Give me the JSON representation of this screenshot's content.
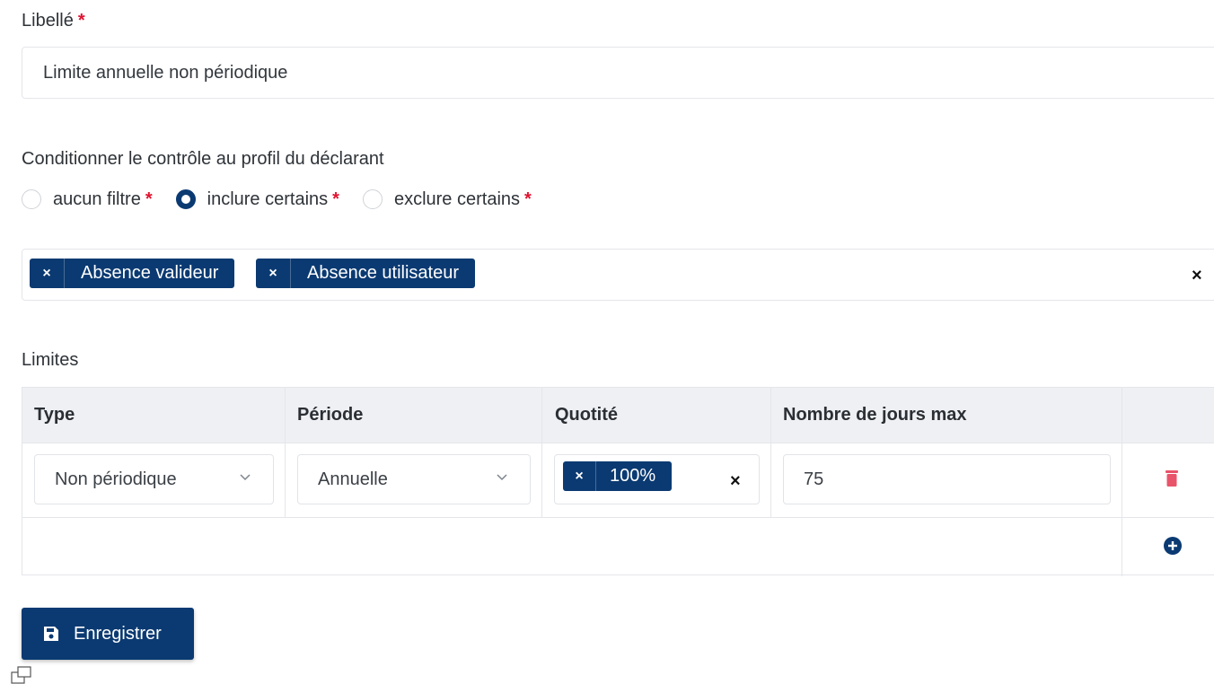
{
  "form": {
    "libelle_label": "Libellé",
    "required_mark": "*",
    "libelle_value": "Limite annuelle non périodique",
    "condition_label": "Conditionner le contrôle au profil du déclarant",
    "radios": [
      {
        "label": "aucun filtre",
        "selected": false
      },
      {
        "label": "inclure certains",
        "selected": true
      },
      {
        "label": "exclure certains",
        "selected": false
      }
    ],
    "profile_tags": [
      "Absence valideur",
      "Absence utilisateur"
    ],
    "tag_remove_glyph": "×",
    "clear_glyph": "×"
  },
  "limits": {
    "section_label": "Limites",
    "headers": {
      "type": "Type",
      "periode": "Période",
      "quotite": "Quotité",
      "jours": "Nombre de jours max"
    },
    "rows": [
      {
        "type": "Non périodique",
        "periode": "Annuelle",
        "quotite_tags": [
          "100%"
        ],
        "jours": "75"
      }
    ]
  },
  "actions": {
    "save_label": "Enregistrer"
  },
  "colors": {
    "primary": "#0b3a72",
    "required": "#e0132f",
    "delete": "#e8546a"
  },
  "icons": [
    "chevron-down-icon",
    "trash-icon",
    "plus-circle-icon",
    "save-icon",
    "window-icon"
  ]
}
